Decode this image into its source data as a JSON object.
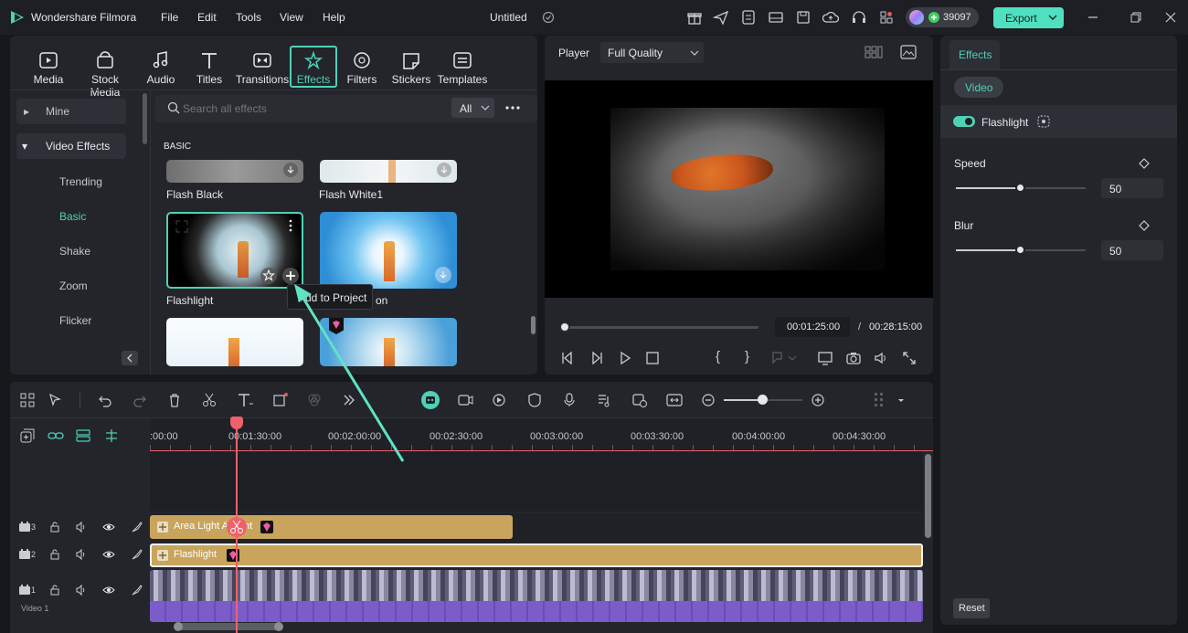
{
  "app": {
    "name": "Wondershare Filmora",
    "project_title": "Untitled",
    "credits": "39097",
    "export_label": "Export"
  },
  "menu": [
    "File",
    "Edit",
    "Tools",
    "View",
    "Help"
  ],
  "toolbar_tabs": [
    {
      "label": "Media",
      "icon": "media-icon"
    },
    {
      "label": "Stock Media",
      "icon": "stock-media-icon"
    },
    {
      "label": "Audio",
      "icon": "audio-icon"
    },
    {
      "label": "Titles",
      "icon": "titles-icon"
    },
    {
      "label": "Transitions",
      "icon": "transitions-icon"
    },
    {
      "label": "Effects",
      "icon": "effects-icon",
      "active": true
    },
    {
      "label": "Filters",
      "icon": "filters-icon"
    },
    {
      "label": "Stickers",
      "icon": "stickers-icon"
    },
    {
      "label": "Templates",
      "icon": "templates-icon"
    }
  ],
  "sidebar": {
    "mine": "Mine",
    "video_effects": "Video Effects",
    "subitems": [
      "Trending",
      "Basic",
      "Shake",
      "Zoom",
      "Flicker"
    ],
    "active": "Basic"
  },
  "effects_browser": {
    "search_placeholder": "Search all effects",
    "filter_value": "All",
    "section": "BASIC",
    "items": [
      "Flash Black",
      "Flash White1",
      "Flashlight"
    ],
    "partial_label": "on",
    "tooltip": "Add to Project"
  },
  "player": {
    "label": "Player",
    "quality": "Full Quality",
    "current_time": "00:01:25:00",
    "separator": "/",
    "total_time": "00:28:15:00",
    "progress": 0.02
  },
  "properties": {
    "tab": "Effects",
    "subtab": "Video",
    "effect_name": "Flashlight",
    "speed_label": "Speed",
    "speed_value": "50",
    "blur_label": "Blur",
    "blur_value": "50",
    "reset_label": "Reset"
  },
  "timeline": {
    "ruler": [
      ":00:00",
      "00:01:30:00",
      "00:02:00:00",
      "00:02:30:00",
      "00:03:00:00",
      "00:03:30:00",
      "00:04:00:00",
      "00:04:30:00"
    ],
    "tracks": [
      {
        "number": "3",
        "clip": "Area Light Accent"
      },
      {
        "number": "2",
        "clip": "Flashlight"
      },
      {
        "number": "1",
        "name": "Video 1"
      }
    ],
    "zoom_level": 0.5
  },
  "colors": {
    "accent": "#4fd1b5",
    "clip_gold": "#c9a45c",
    "video_purple": "#7b5cc9",
    "playhead": "#f0606a"
  }
}
